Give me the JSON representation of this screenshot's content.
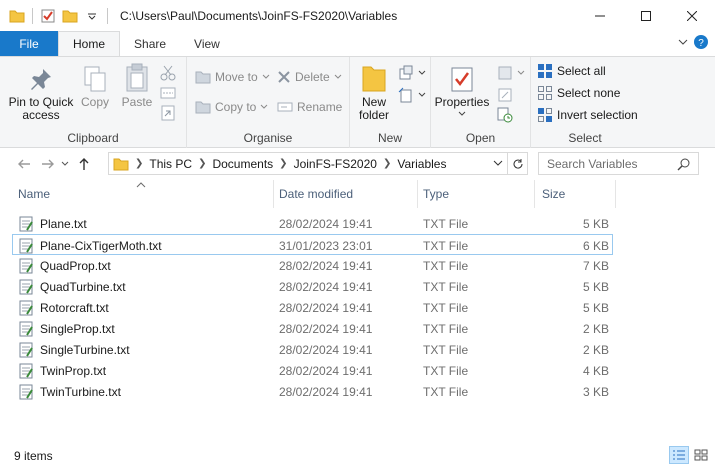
{
  "window": {
    "path": "C:\\Users\\Paul\\Documents\\JoinFS-FS2020\\Variables"
  },
  "tabs": [
    "File",
    "Home",
    "Share",
    "View"
  ],
  "ribbon": {
    "clipboard": {
      "label": "Clipboard",
      "pin": "Pin to Quick access",
      "copy": "Copy",
      "paste": "Paste"
    },
    "organise": {
      "label": "Organise",
      "move_to": "Move to",
      "copy_to": "Copy to",
      "delete": "Delete",
      "rename": "Rename"
    },
    "new": {
      "label": "New",
      "new_folder": "New folder"
    },
    "open": {
      "label": "Open",
      "properties": "Properties"
    },
    "select": {
      "label": "Select",
      "select_all": "Select all",
      "select_none": "Select none",
      "invert": "Invert selection"
    }
  },
  "address": {
    "crumbs": [
      "This PC",
      "Documents",
      "JoinFS-FS2020",
      "Variables"
    ],
    "search_placeholder": "Search Variables"
  },
  "columns": {
    "name": "Name",
    "date": "Date modified",
    "type": "Type",
    "size": "Size"
  },
  "files": [
    {
      "name": "Plane.txt",
      "date": "28/02/2024 19:41",
      "type": "TXT File",
      "size": "5 KB"
    },
    {
      "name": "Plane-CixTigerMoth.txt",
      "date": "31/01/2023 23:01",
      "type": "TXT File",
      "size": "6 KB"
    },
    {
      "name": "QuadProp.txt",
      "date": "28/02/2024 19:41",
      "type": "TXT File",
      "size": "7 KB"
    },
    {
      "name": "QuadTurbine.txt",
      "date": "28/02/2024 19:41",
      "type": "TXT File",
      "size": "5 KB"
    },
    {
      "name": "Rotorcraft.txt",
      "date": "28/02/2024 19:41",
      "type": "TXT File",
      "size": "5 KB"
    },
    {
      "name": "SingleProp.txt",
      "date": "28/02/2024 19:41",
      "type": "TXT File",
      "size": "2 KB"
    },
    {
      "name": "SingleTurbine.txt",
      "date": "28/02/2024 19:41",
      "type": "TXT File",
      "size": "2 KB"
    },
    {
      "name": "TwinProp.txt",
      "date": "28/02/2024 19:41",
      "type": "TXT File",
      "size": "4 KB"
    },
    {
      "name": "TwinTurbine.txt",
      "date": "28/02/2024 19:41",
      "type": "TXT File",
      "size": "3 KB"
    }
  ],
  "status": {
    "count": "9 items"
  },
  "colors": {
    "file_tab": "#1979ca",
    "folder": "#f4c542",
    "selection_border": "#99c9ef"
  }
}
